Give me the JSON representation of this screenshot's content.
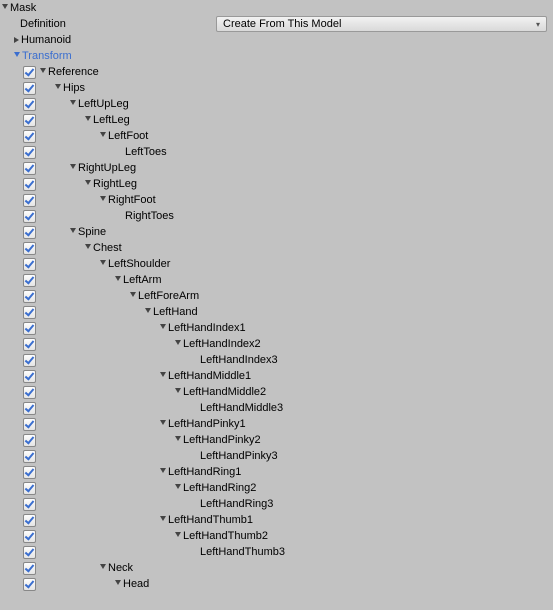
{
  "section": {
    "title": "Mask"
  },
  "definition": {
    "label": "Definition",
    "value": "Create From This Model"
  },
  "toggles": {
    "humanoid": "Humanoid",
    "transform": "Transform"
  },
  "tree": [
    {
      "d": 0,
      "f": 1,
      "c": 1,
      "n": "Reference"
    },
    {
      "d": 1,
      "f": 1,
      "c": 1,
      "n": "Hips"
    },
    {
      "d": 2,
      "f": 1,
      "c": 1,
      "n": "LeftUpLeg"
    },
    {
      "d": 3,
      "f": 1,
      "c": 1,
      "n": "LeftLeg"
    },
    {
      "d": 4,
      "f": 1,
      "c": 1,
      "n": "LeftFoot"
    },
    {
      "d": 5,
      "f": 0,
      "c": 1,
      "n": "LeftToes"
    },
    {
      "d": 2,
      "f": 1,
      "c": 1,
      "n": "RightUpLeg"
    },
    {
      "d": 3,
      "f": 1,
      "c": 1,
      "n": "RightLeg"
    },
    {
      "d": 4,
      "f": 1,
      "c": 1,
      "n": "RightFoot"
    },
    {
      "d": 5,
      "f": 0,
      "c": 1,
      "n": "RightToes"
    },
    {
      "d": 2,
      "f": 1,
      "c": 1,
      "n": "Spine"
    },
    {
      "d": 3,
      "f": 1,
      "c": 1,
      "n": "Chest"
    },
    {
      "d": 4,
      "f": 1,
      "c": 1,
      "n": "LeftShoulder"
    },
    {
      "d": 5,
      "f": 1,
      "c": 1,
      "n": "LeftArm"
    },
    {
      "d": 6,
      "f": 1,
      "c": 1,
      "n": "LeftForeArm"
    },
    {
      "d": 7,
      "f": 1,
      "c": 1,
      "n": "LeftHand"
    },
    {
      "d": 8,
      "f": 1,
      "c": 1,
      "n": "LeftHandIndex1"
    },
    {
      "d": 9,
      "f": 1,
      "c": 1,
      "n": "LeftHandIndex2"
    },
    {
      "d": 10,
      "f": 0,
      "c": 1,
      "n": "LeftHandIndex3"
    },
    {
      "d": 8,
      "f": 1,
      "c": 1,
      "n": "LeftHandMiddle1"
    },
    {
      "d": 9,
      "f": 1,
      "c": 1,
      "n": "LeftHandMiddle2"
    },
    {
      "d": 10,
      "f": 0,
      "c": 1,
      "n": "LeftHandMiddle3"
    },
    {
      "d": 8,
      "f": 1,
      "c": 1,
      "n": "LeftHandPinky1"
    },
    {
      "d": 9,
      "f": 1,
      "c": 1,
      "n": "LeftHandPinky2"
    },
    {
      "d": 10,
      "f": 0,
      "c": 1,
      "n": "LeftHandPinky3"
    },
    {
      "d": 8,
      "f": 1,
      "c": 1,
      "n": "LeftHandRing1"
    },
    {
      "d": 9,
      "f": 1,
      "c": 1,
      "n": "LeftHandRing2"
    },
    {
      "d": 10,
      "f": 0,
      "c": 1,
      "n": "LeftHandRing3"
    },
    {
      "d": 8,
      "f": 1,
      "c": 1,
      "n": "LeftHandThumb1"
    },
    {
      "d": 9,
      "f": 1,
      "c": 1,
      "n": "LeftHandThumb2"
    },
    {
      "d": 10,
      "f": 0,
      "c": 1,
      "n": "LeftHandThumb3"
    },
    {
      "d": 4,
      "f": 1,
      "c": 1,
      "n": "Neck"
    },
    {
      "d": 5,
      "f": 1,
      "c": 1,
      "n": "Head"
    }
  ]
}
